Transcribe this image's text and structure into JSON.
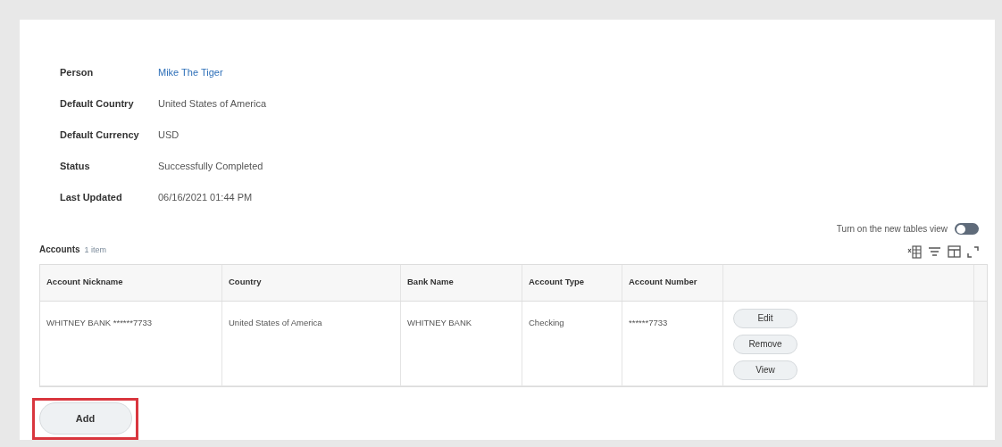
{
  "details": [
    {
      "label": "Person",
      "value": "Mike The Tiger",
      "kind": "link"
    },
    {
      "label": "Default Country",
      "value": "United States of America",
      "kind": "text"
    },
    {
      "label": "Default Currency",
      "value": "USD",
      "kind": "text"
    },
    {
      "label": "Status",
      "value": "Successfully Completed",
      "kind": "text"
    },
    {
      "label": "Last Updated",
      "value": "06/16/2021 01:44 PM",
      "kind": "text"
    }
  ],
  "tables_view_toggle": {
    "label": "Turn on the new tables view",
    "on": false
  },
  "accounts": {
    "title": "Accounts",
    "count": "1 item",
    "columns": [
      "Account Nickname",
      "Country",
      "Bank Name",
      "Account Type",
      "Account Number"
    ],
    "rows": [
      {
        "cells": [
          "WHITNEY BANK ******7733",
          "United States of America",
          "WHITNEY BANK",
          "Checking",
          "******7733"
        ],
        "actions": [
          "Edit",
          "Remove",
          "View"
        ]
      }
    ]
  },
  "add_button": {
    "label": "Add",
    "highlighted": true
  }
}
